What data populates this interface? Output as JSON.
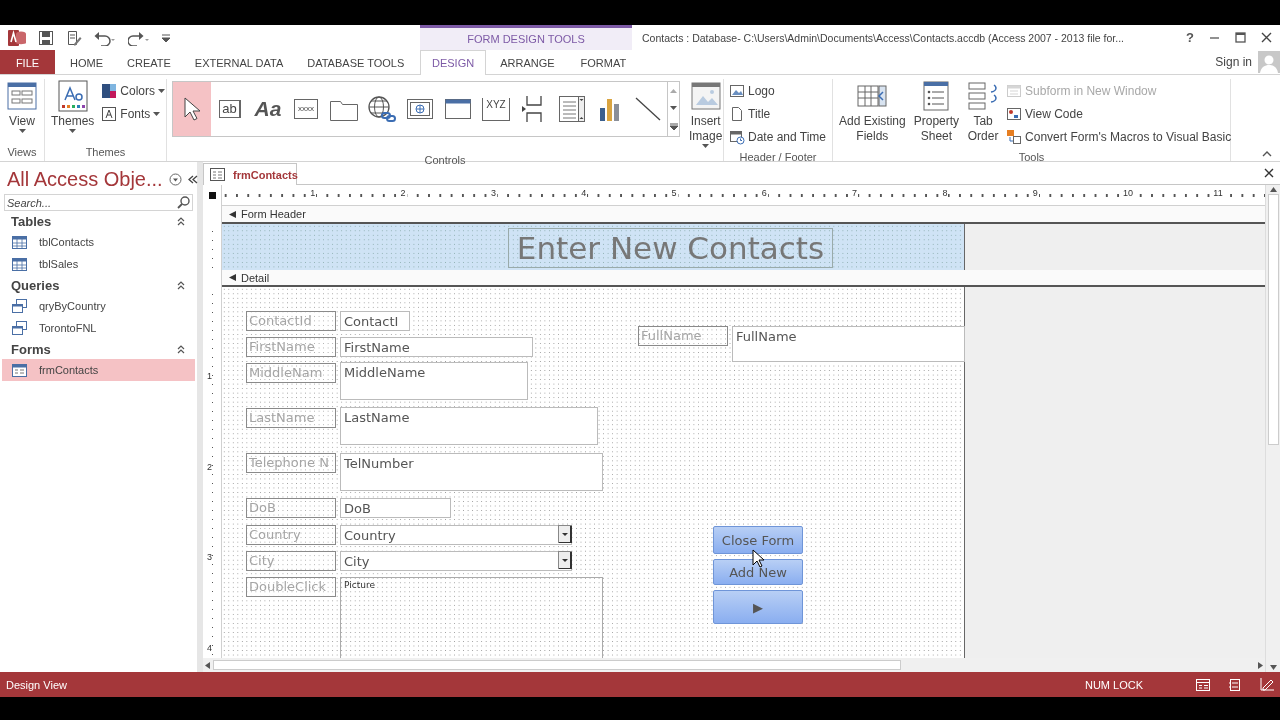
{
  "title_bar": {
    "context_group": "FORM DESIGN TOOLS",
    "title": "Contacts : Database- C:\\Users\\Admin\\Documents\\Access\\Contacts.accdb (Access 2007 - 2013 file for...",
    "help": "?"
  },
  "tabs": [
    {
      "label": "FILE",
      "kind": "file",
      "selected": false
    },
    {
      "label": "HOME",
      "kind": "main",
      "selected": false
    },
    {
      "label": "CREATE",
      "kind": "main",
      "selected": false
    },
    {
      "label": "EXTERNAL DATA",
      "kind": "main",
      "selected": false
    },
    {
      "label": "DATABASE TOOLS",
      "kind": "main",
      "selected": false
    },
    {
      "label": "DESIGN",
      "kind": "context",
      "selected": true
    },
    {
      "label": "ARRANGE",
      "kind": "context",
      "selected": false
    },
    {
      "label": "FORMAT",
      "kind": "context",
      "selected": false
    }
  ],
  "account": {
    "label": "Sign in"
  },
  "ribbon": [
    {
      "label": "Views",
      "items": [
        {
          "kind": "view",
          "lines": [
            "View"
          ],
          "dropdown": true,
          "disabled": false
        }
      ]
    },
    {
      "label": "Themes",
      "items": [
        {
          "kind": "themes",
          "lines": [
            "Themes"
          ],
          "dropdown": true,
          "disabled": false
        },
        {
          "kind": "colors",
          "lines": [
            "Colors"
          ],
          "dropdown": true,
          "disabled": false
        },
        {
          "kind": "fonts",
          "lines": [
            "Fonts"
          ],
          "dropdown": true,
          "disabled": false
        }
      ]
    },
    {
      "label": "Controls",
      "gallery": [
        {
          "kind": "pointer",
          "selected": true
        },
        {
          "kind": "textbox",
          "glyph": "ab",
          "selected": false
        },
        {
          "kind": "label",
          "glyph": "Aa",
          "selected": false
        },
        {
          "kind": "button",
          "glyph": "xxxx",
          "selected": false
        },
        {
          "kind": "tab",
          "selected": false
        },
        {
          "kind": "hyperlink",
          "selected": false
        },
        {
          "kind": "browser",
          "selected": false
        },
        {
          "kind": "navigation",
          "selected": false
        },
        {
          "kind": "optiongroup",
          "glyph": "XYZ",
          "selected": false
        },
        {
          "kind": "pagebreak",
          "selected": false
        },
        {
          "kind": "combo",
          "selected": false
        },
        {
          "kind": "chart",
          "selected": false
        },
        {
          "kind": "line",
          "selected": false
        }
      ],
      "items": [
        {
          "kind": "image",
          "lines": [
            "Insert",
            "Image"
          ],
          "dropdown": true,
          "disabled": false
        }
      ]
    },
    {
      "label": "Header / Footer",
      "items": [
        {
          "kind": "logo",
          "lines": [
            "Logo"
          ],
          "dropdown": false,
          "disabled": false
        },
        {
          "kind": "title",
          "lines": [
            "Title"
          ],
          "dropdown": false,
          "disabled": false
        },
        {
          "kind": "datetime",
          "lines": [
            "Date and Time"
          ],
          "dropdown": false,
          "disabled": false
        }
      ]
    },
    {
      "label": "Tools",
      "items": [
        {
          "kind": "addfields",
          "lines": [
            "Add Existing",
            "Fields"
          ],
          "dropdown": false,
          "disabled": false
        },
        {
          "kind": "property",
          "lines": [
            "Property",
            "Sheet"
          ],
          "dropdown": false,
          "disabled": false
        },
        {
          "kind": "taborder",
          "lines": [
            "Tab",
            "Order"
          ],
          "dropdown": false,
          "disabled": false
        },
        {
          "kind": "subform",
          "lines": [
            "Subform in New Window"
          ],
          "dropdown": false,
          "disabled": true
        },
        {
          "kind": "viewcode",
          "lines": [
            "View Code"
          ],
          "dropdown": false,
          "disabled": false
        },
        {
          "kind": "macros",
          "lines": [
            "Convert Form's Macros to Visual Basic"
          ],
          "dropdown": false,
          "disabled": false
        }
      ]
    }
  ],
  "navigation_pane": {
    "title": "All Access Obje...",
    "search": {
      "placeholder": "Search..."
    },
    "groups": [
      {
        "label": "Tables",
        "expanded": true,
        "items": [
          {
            "label": "tblContacts",
            "kind": "table",
            "selected": false
          },
          {
            "label": "tblSales",
            "kind": "table",
            "selected": false
          }
        ]
      },
      {
        "label": "Queries",
        "expanded": true,
        "items": [
          {
            "label": "qryByCountry",
            "kind": "query",
            "selected": false
          },
          {
            "label": "TorontoFNL",
            "kind": "query",
            "selected": false
          }
        ]
      },
      {
        "label": "Forms",
        "expanded": true,
        "items": [
          {
            "label": "frmContacts",
            "kind": "form",
            "selected": true
          }
        ]
      }
    ]
  },
  "document": {
    "tab": "frmContacts",
    "ruler": [
      "1",
      "2",
      "3",
      "4",
      "5",
      "6",
      "7",
      "8",
      "9",
      "10",
      "11"
    ],
    "vertical_ruler": [
      "1",
      "2",
      "3",
      "4"
    ],
    "sections": [
      {
        "kind": "header",
        "bar": "Form Header",
        "controls": [
          {
            "kind": "title",
            "text": "Enter New Contacts"
          }
        ]
      },
      {
        "kind": "detail",
        "bar": "Detail",
        "controls": [
          {
            "kind": "label",
            "text": "ContactId"
          },
          {
            "kind": "textbox",
            "text": "ContactI"
          },
          {
            "kind": "label",
            "text": "FirstName"
          },
          {
            "kind": "textbox",
            "text": "FirstName"
          },
          {
            "kind": "label",
            "text": "MiddleNam"
          },
          {
            "kind": "textbox",
            "text": "MiddleName"
          },
          {
            "kind": "label",
            "text": "LastName"
          },
          {
            "kind": "textbox",
            "text": "LastName"
          },
          {
            "kind": "label",
            "text": "Telephone N"
          },
          {
            "kind": "textbox",
            "text": "TelNumber"
          },
          {
            "kind": "label",
            "text": "DoB"
          },
          {
            "kind": "textbox",
            "text": "DoB"
          },
          {
            "kind": "label",
            "text": "Country"
          },
          {
            "kind": "combo",
            "text": "Country"
          },
          {
            "kind": "label",
            "text": "City"
          },
          {
            "kind": "combo",
            "text": "City"
          },
          {
            "kind": "label",
            "text": "DoubleClick"
          },
          {
            "kind": "image",
            "text": "Picture"
          },
          {
            "kind": "label",
            "text": "FullName"
          },
          {
            "kind": "textbox",
            "text": "FullName"
          },
          {
            "kind": "button",
            "text": "Close Form"
          },
          {
            "kind": "button",
            "text": "Add New"
          },
          {
            "kind": "button",
            "text": "▶"
          }
        ]
      }
    ]
  },
  "status_bar": {
    "mode": "Design View",
    "indicator": "NUM LOCK"
  }
}
